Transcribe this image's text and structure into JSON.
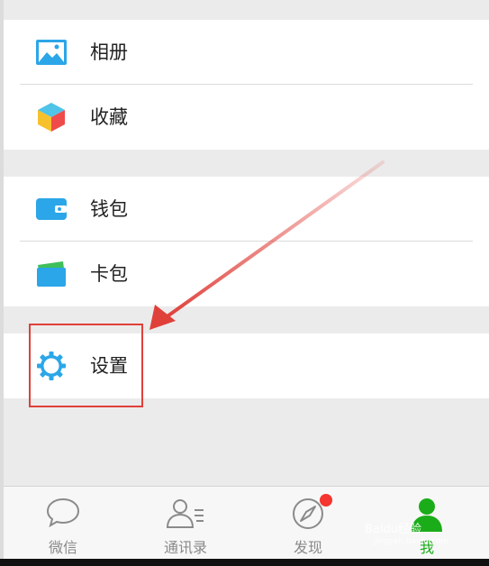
{
  "menu": {
    "album_label": "相册",
    "favorites_label": "收藏",
    "wallet_label": "钱包",
    "cards_label": "卡包",
    "settings_label": "设置"
  },
  "tabs": [
    {
      "label": "微信",
      "icon": "chat-bubble-icon"
    },
    {
      "label": "通讯录",
      "icon": "contacts-icon"
    },
    {
      "label": "发现",
      "icon": "compass-icon"
    },
    {
      "label": "我",
      "icon": "person-icon"
    }
  ],
  "active_tab": "我",
  "colors": {
    "accent_blue": "#2ba6e8",
    "active_green": "#1aad19",
    "badge_red": "#f43530",
    "annotation_red": "#e0403a"
  },
  "watermark": {
    "text": "Baidu经验",
    "sub": "jingyan.baidu.com"
  }
}
